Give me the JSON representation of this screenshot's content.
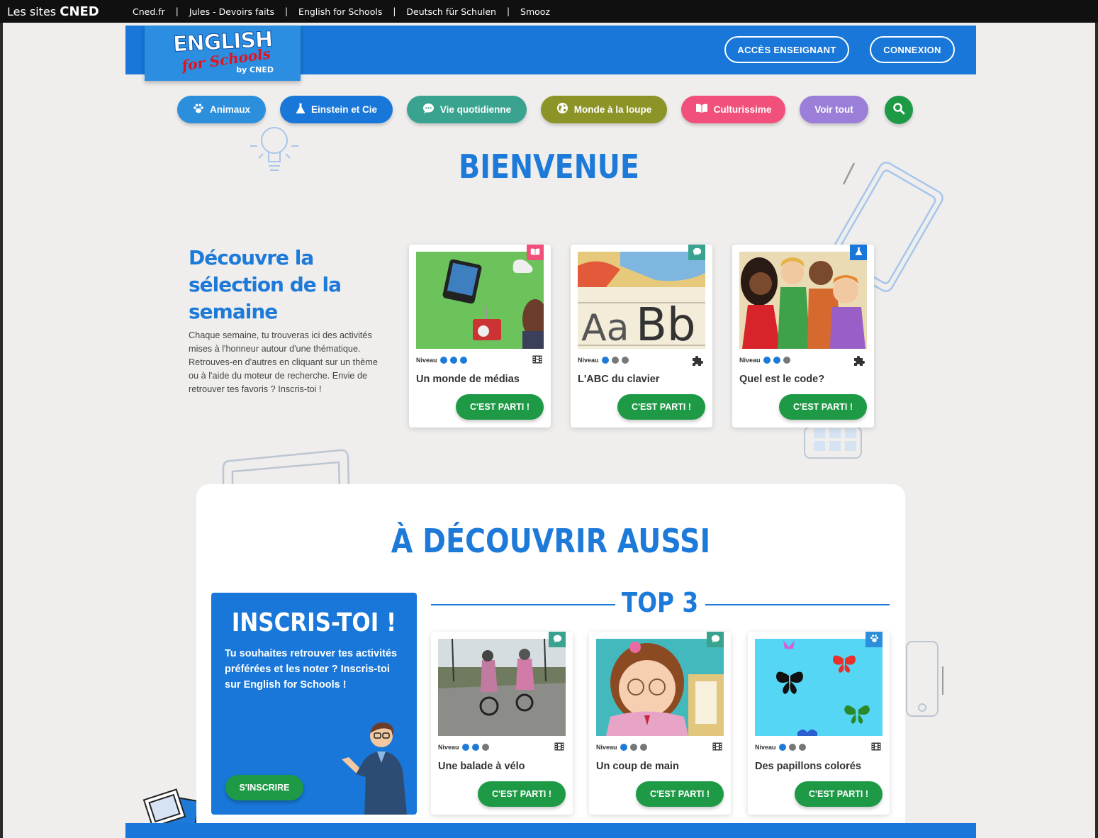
{
  "cned_bar": {
    "brand_prefix": "Les sites",
    "brand_name": "CNED",
    "links": [
      "Cned.fr",
      "Jules - Devoirs faits",
      "English for Schools",
      "Deutsch für Schulen",
      "Smooz"
    ],
    "separator": "|"
  },
  "header": {
    "logo": {
      "line1": "ENGLISH",
      "line2": "for Schools",
      "line3": "by CNED"
    },
    "teacher_button": "ACCÈS ENSEIGNANT",
    "login_button": "CONNEXION",
    "color": "#1877d8"
  },
  "categories": [
    {
      "label": "Animaux",
      "icon": "paw-icon",
      "color": "#2b8fdc"
    },
    {
      "label": "Einstein et Cie",
      "icon": "flask-icon",
      "color": "#1877d8"
    },
    {
      "label": "Vie quotidienne",
      "icon": "chat-bubble-icon",
      "color": "#3aa38f"
    },
    {
      "label": "Monde à la loupe",
      "icon": "globe-icon",
      "color": "#8d9427"
    },
    {
      "label": "Culturissime",
      "icon": "book-icon",
      "color": "#f0507a"
    },
    {
      "label": "Voir tout",
      "icon": "",
      "color": "#9a7ed8"
    }
  ],
  "search": {
    "icon": "search-icon"
  },
  "welcome": {
    "title": "BIENVENUE"
  },
  "selection": {
    "title": "Découvre la sélection de la semaine",
    "text": "Chaque semaine, tu trouveras ici des activités mises à l'honneur autour d'une thématique. Retrouves-en d'autres en cliquant sur un thème ou à l'aide du moteur de recherche. Envie de retrouver tes favoris ? Inscris-toi !",
    "cards": [
      {
        "title": "Un monde de médias",
        "niveau_label": "Niveau",
        "level": 3,
        "badge_icon": "book-icon",
        "badge_color": "#f0507a",
        "type_icon": "film-icon",
        "button": "C'EST PARTI !"
      },
      {
        "title": "L'ABC du clavier",
        "niveau_label": "Niveau",
        "level": 1,
        "badge_icon": "chat-bubble-icon",
        "badge_color": "#3aa38f",
        "type_icon": "puzzle-icon",
        "button": "C'EST PARTI !"
      },
      {
        "title": "Quel est le code?",
        "niveau_label": "Niveau",
        "level": 2,
        "badge_icon": "flask-icon",
        "badge_color": "#1877d8",
        "type_icon": "puzzle-icon",
        "button": "C'EST PARTI !"
      }
    ]
  },
  "discover": {
    "title": "À DÉCOUVRIR AUSSI",
    "signup": {
      "title": "INSCRIS-TOI !",
      "text": "Tu souhaites retrouver tes activités préférées et les noter ? Inscris-toi sur English for Schools !",
      "button": "S'INSCRIRE"
    },
    "top3_title": "TOP 3",
    "cards": [
      {
        "title": "Une balade à vélo",
        "niveau_label": "Niveau",
        "level": 2,
        "badge_icon": "chat-bubble-icon",
        "badge_color": "#3aa38f",
        "type_icon": "film-icon",
        "button": "C'EST PARTI !"
      },
      {
        "title": "Un coup de main",
        "niveau_label": "Niveau",
        "level": 1,
        "badge_icon": "chat-bubble-icon",
        "badge_color": "#3aa38f",
        "type_icon": "film-icon",
        "button": "C'EST PARTI !"
      },
      {
        "title": "Des papillons colorés",
        "niveau_label": "Niveau",
        "level": 1,
        "badge_icon": "paw-icon",
        "badge_color": "#2b8fdc",
        "type_icon": "film-icon",
        "button": "C'EST PARTI !"
      }
    ]
  }
}
